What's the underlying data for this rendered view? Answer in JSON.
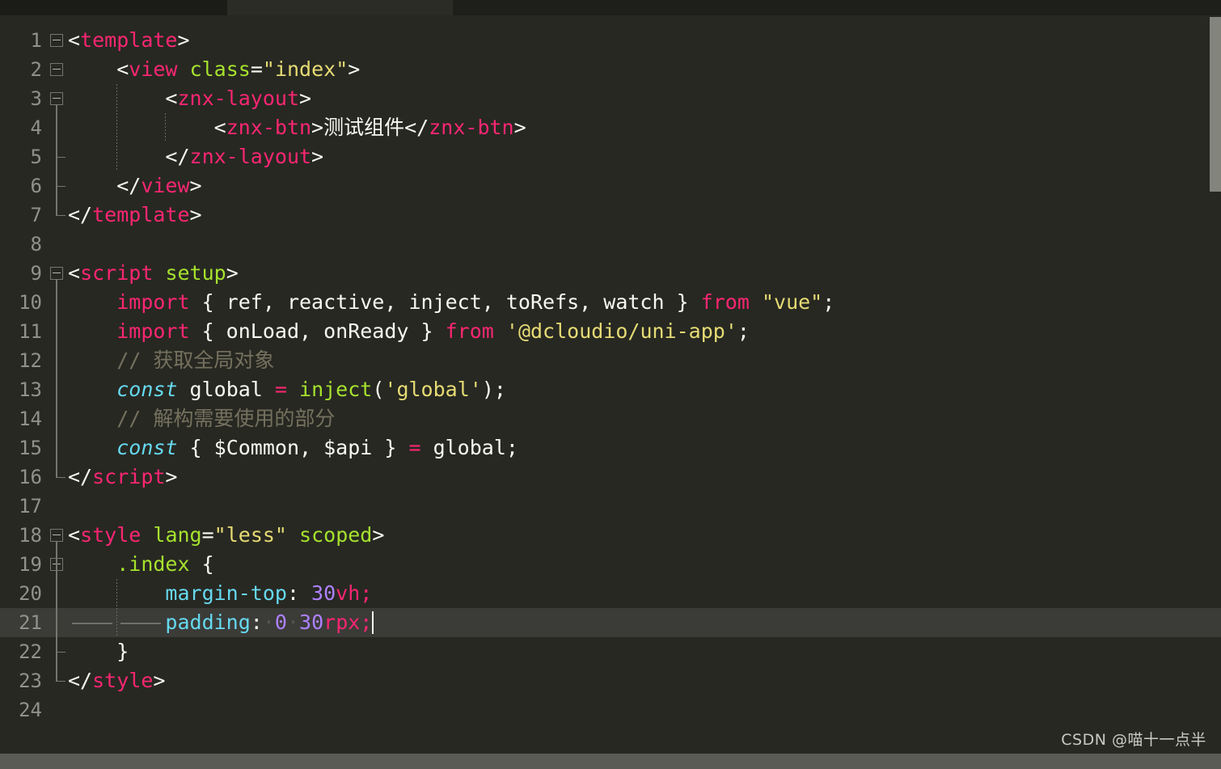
{
  "window": {
    "tabstrip_segments": [
      "tab-left",
      "tab-middle",
      "tab-right"
    ]
  },
  "editor": {
    "language": "vue",
    "theme": "Monokai",
    "background_color": "#272822",
    "current_line_number": 21,
    "current_line_background": "#3b3b38",
    "caret_color": "#f8f8f0",
    "line_number_color": "#90918b",
    "total_lines": 24,
    "colors": {
      "tag": "#f92672",
      "keyword": "#f92672",
      "attribute": "#a6e22e",
      "string": "#e6db74",
      "comment": "#75715e",
      "declaration": "#66d9ef",
      "property": "#66d9ef",
      "number": "#ae81ff",
      "function": "#a6e22e",
      "text": "#f8f8f2"
    },
    "lines": [
      {
        "n": "1",
        "fold": true,
        "indent_dotted": [],
        "tokens": [
          {
            "t": "<",
            "c": "t-punc"
          },
          {
            "t": "template",
            "c": "t-tag"
          },
          {
            "t": ">",
            "c": "t-punc"
          }
        ]
      },
      {
        "n": "2",
        "fold": true,
        "indent_dotted": [],
        "tokens": [
          {
            "t": "    ",
            "c": "t-punc"
          },
          {
            "t": "<",
            "c": "t-punc"
          },
          {
            "t": "view",
            "c": "t-tag"
          },
          {
            "t": " ",
            "c": "t-punc"
          },
          {
            "t": "class",
            "c": "t-attr"
          },
          {
            "t": "=",
            "c": "t-punc"
          },
          {
            "t": "\"index\"",
            "c": "t-str"
          },
          {
            "t": ">",
            "c": "t-punc"
          }
        ]
      },
      {
        "n": "3",
        "fold": true,
        "indent_dotted": [
          0
        ],
        "tokens": [
          {
            "t": "        ",
            "c": "t-punc"
          },
          {
            "t": "<",
            "c": "t-punc"
          },
          {
            "t": "znx-layout",
            "c": "t-tag"
          },
          {
            "t": ">",
            "c": "t-punc"
          }
        ]
      },
      {
        "n": "4",
        "fold": false,
        "indent_dotted": [
          0,
          1
        ],
        "tokens": [
          {
            "t": "            ",
            "c": "t-punc"
          },
          {
            "t": "<",
            "c": "t-punc"
          },
          {
            "t": "znx-btn",
            "c": "t-tag"
          },
          {
            "t": ">",
            "c": "t-punc"
          },
          {
            "t": "测试组件",
            "c": "t-cjk"
          },
          {
            "t": "</",
            "c": "t-punc"
          },
          {
            "t": "znx-btn",
            "c": "t-tag"
          },
          {
            "t": ">",
            "c": "t-punc"
          }
        ]
      },
      {
        "n": "5",
        "fold": false,
        "branch": true,
        "indent_dotted": [
          0
        ],
        "tokens": [
          {
            "t": "        ",
            "c": "t-punc"
          },
          {
            "t": "</",
            "c": "t-punc"
          },
          {
            "t": "znx-layout",
            "c": "t-tag"
          },
          {
            "t": ">",
            "c": "t-punc"
          }
        ]
      },
      {
        "n": "6",
        "fold": false,
        "branch": true,
        "indent_dotted": [],
        "tokens": [
          {
            "t": "    ",
            "c": "t-punc"
          },
          {
            "t": "</",
            "c": "t-punc"
          },
          {
            "t": "view",
            "c": "t-tag"
          },
          {
            "t": ">",
            "c": "t-punc"
          }
        ]
      },
      {
        "n": "7",
        "fold": false,
        "elbow": true,
        "indent_dotted": [],
        "tokens": [
          {
            "t": "</",
            "c": "t-punc"
          },
          {
            "t": "template",
            "c": "t-tag"
          },
          {
            "t": ">",
            "c": "t-punc"
          }
        ]
      },
      {
        "n": "8",
        "fold": false,
        "indent_dotted": [],
        "tokens": []
      },
      {
        "n": "9",
        "fold": true,
        "indent_dotted": [],
        "tokens": [
          {
            "t": "<",
            "c": "t-punc"
          },
          {
            "t": "script",
            "c": "t-tag"
          },
          {
            "t": " ",
            "c": "t-punc"
          },
          {
            "t": "setup",
            "c": "t-attr"
          },
          {
            "t": ">",
            "c": "t-punc"
          }
        ]
      },
      {
        "n": "10",
        "fold": false,
        "vline": true,
        "indent_dotted": [],
        "tokens": [
          {
            "t": "    ",
            "c": "t-punc"
          },
          {
            "t": "import",
            "c": "t-kw"
          },
          {
            "t": " { ref, reactive, inject, toRefs, watch } ",
            "c": "t-var"
          },
          {
            "t": "from",
            "c": "t-kw"
          },
          {
            "t": " ",
            "c": "t-punc"
          },
          {
            "t": "\"vue\"",
            "c": "t-str"
          },
          {
            "t": ";",
            "c": "t-punc"
          }
        ]
      },
      {
        "n": "11",
        "fold": false,
        "vline": true,
        "indent_dotted": [],
        "tokens": [
          {
            "t": "    ",
            "c": "t-punc"
          },
          {
            "t": "import",
            "c": "t-kw"
          },
          {
            "t": " { onLoad, onReady } ",
            "c": "t-var"
          },
          {
            "t": "from",
            "c": "t-kw"
          },
          {
            "t": " ",
            "c": "t-punc"
          },
          {
            "t": "'@dcloudio/uni-app'",
            "c": "t-str"
          },
          {
            "t": ";",
            "c": "t-punc"
          }
        ]
      },
      {
        "n": "12",
        "fold": false,
        "vline": true,
        "indent_dotted": [],
        "tokens": [
          {
            "t": "    ",
            "c": "t-punc"
          },
          {
            "t": "// ",
            "c": "t-com"
          },
          {
            "t": "获取全局对象",
            "c": "t-com",
            "cjk": true
          }
        ]
      },
      {
        "n": "13",
        "fold": false,
        "vline": true,
        "indent_dotted": [],
        "tokens": [
          {
            "t": "    ",
            "c": "t-punc"
          },
          {
            "t": "const",
            "c": "t-decl"
          },
          {
            "t": " global ",
            "c": "t-var"
          },
          {
            "t": "=",
            "c": "t-op"
          },
          {
            "t": " ",
            "c": "t-punc"
          },
          {
            "t": "inject",
            "c": "t-fn"
          },
          {
            "t": "(",
            "c": "t-punc"
          },
          {
            "t": "'global'",
            "c": "t-str"
          },
          {
            "t": ");",
            "c": "t-punc"
          }
        ]
      },
      {
        "n": "14",
        "fold": false,
        "vline": true,
        "indent_dotted": [],
        "tokens": [
          {
            "t": "    ",
            "c": "t-punc"
          },
          {
            "t": "// ",
            "c": "t-com"
          },
          {
            "t": "解构需要使用的部分",
            "c": "t-com",
            "cjk": true
          }
        ]
      },
      {
        "n": "15",
        "fold": false,
        "vline": true,
        "indent_dotted": [],
        "tokens": [
          {
            "t": "    ",
            "c": "t-punc"
          },
          {
            "t": "const",
            "c": "t-decl"
          },
          {
            "t": " { $Common, $api } ",
            "c": "t-var"
          },
          {
            "t": "=",
            "c": "t-op"
          },
          {
            "t": " global;",
            "c": "t-var"
          }
        ]
      },
      {
        "n": "16",
        "fold": false,
        "elbow": true,
        "indent_dotted": [],
        "tokens": [
          {
            "t": "</",
            "c": "t-punc"
          },
          {
            "t": "script",
            "c": "t-tag"
          },
          {
            "t": ">",
            "c": "t-punc"
          }
        ]
      },
      {
        "n": "17",
        "fold": false,
        "indent_dotted": [],
        "tokens": []
      },
      {
        "n": "18",
        "fold": true,
        "indent_dotted": [],
        "tokens": [
          {
            "t": "<",
            "c": "t-punc"
          },
          {
            "t": "style",
            "c": "t-tag"
          },
          {
            "t": " ",
            "c": "t-punc"
          },
          {
            "t": "lang",
            "c": "t-attr"
          },
          {
            "t": "=",
            "c": "t-punc"
          },
          {
            "t": "\"less\"",
            "c": "t-str"
          },
          {
            "t": " ",
            "c": "t-punc"
          },
          {
            "t": "scoped",
            "c": "t-attr"
          },
          {
            "t": ">",
            "c": "t-punc"
          }
        ]
      },
      {
        "n": "19",
        "fold": true,
        "indent_dotted": [],
        "tokens": [
          {
            "t": "    ",
            "c": "t-punc"
          },
          {
            "t": ".index",
            "c": "t-sel"
          },
          {
            "t": " {",
            "c": "t-punc"
          }
        ]
      },
      {
        "n": "20",
        "fold": false,
        "vline": true,
        "indent_dotted": [
          0
        ],
        "tokens": [
          {
            "t": "        ",
            "c": "t-punc"
          },
          {
            "t": "margin-top",
            "c": "t-prop"
          },
          {
            "t": ": ",
            "c": "t-punc"
          },
          {
            "t": "30",
            "c": "t-num"
          },
          {
            "t": "vh",
            "c": "t-unit"
          },
          {
            "t": ";",
            "c": "t-unit"
          }
        ]
      },
      {
        "n": "21",
        "fold": false,
        "vline": true,
        "current": true,
        "indent_dotted": [
          0
        ],
        "tokens": [
          {
            "t": "        ",
            "c": "t-punc"
          },
          {
            "t": "padding",
            "c": "t-prop"
          },
          {
            "t": ":",
            "c": "t-punc"
          },
          {
            "t": "·",
            "c": "t-ws"
          },
          {
            "t": "0",
            "c": "t-num"
          },
          {
            "t": "·",
            "c": "t-ws"
          },
          {
            "t": "30",
            "c": "t-num"
          },
          {
            "t": "rpx",
            "c": "t-unit"
          },
          {
            "t": ";",
            "c": "t-unit"
          }
        ]
      },
      {
        "n": "22",
        "fold": false,
        "branch": true,
        "indent_dotted": [],
        "tokens": [
          {
            "t": "    }",
            "c": "t-punc"
          }
        ]
      },
      {
        "n": "23",
        "fold": false,
        "elbow": true,
        "indent_dotted": [],
        "tokens": [
          {
            "t": "</",
            "c": "t-punc"
          },
          {
            "t": "style",
            "c": "t-tag"
          },
          {
            "t": ">",
            "c": "t-punc"
          }
        ]
      },
      {
        "n": "24",
        "fold": false,
        "indent_dotted": [],
        "tokens": []
      }
    ]
  },
  "scrollbars": {
    "vertical_thumb_color": "#83847c",
    "horizontal_track_color": "#5a5b55"
  },
  "watermark": {
    "text": "CSDN @喵十一点半"
  }
}
